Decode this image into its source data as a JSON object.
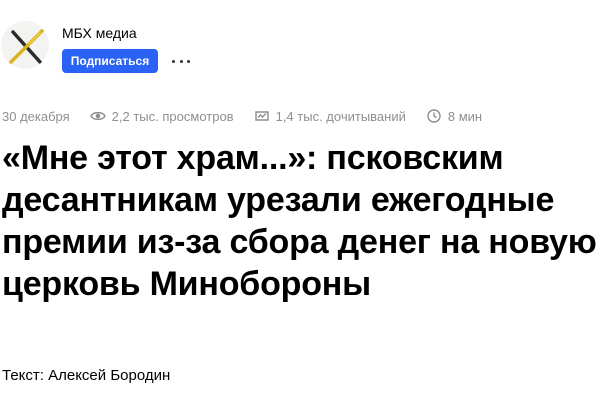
{
  "channel": {
    "name": "МБХ медиа",
    "subscribe_label": "Подписаться",
    "more_icon": "ellipsis-icon",
    "logo_icon": "mbh-logo-icon",
    "accent_color": "#2962f5"
  },
  "meta": {
    "date": "30 декабря",
    "views": "2,2 тыс. просмотров",
    "reads": "1,4 тыс. дочитываний",
    "read_time": "8 мин",
    "icons": [
      "eye-icon",
      "reads-icon",
      "clock-icon"
    ]
  },
  "article": {
    "title": "«Мне этот храм...»: псковским десантникам урезали ежегодные премии из-за сбора денег на новую церковь Минобороны",
    "author": "Текст: Алексей Бородин"
  }
}
